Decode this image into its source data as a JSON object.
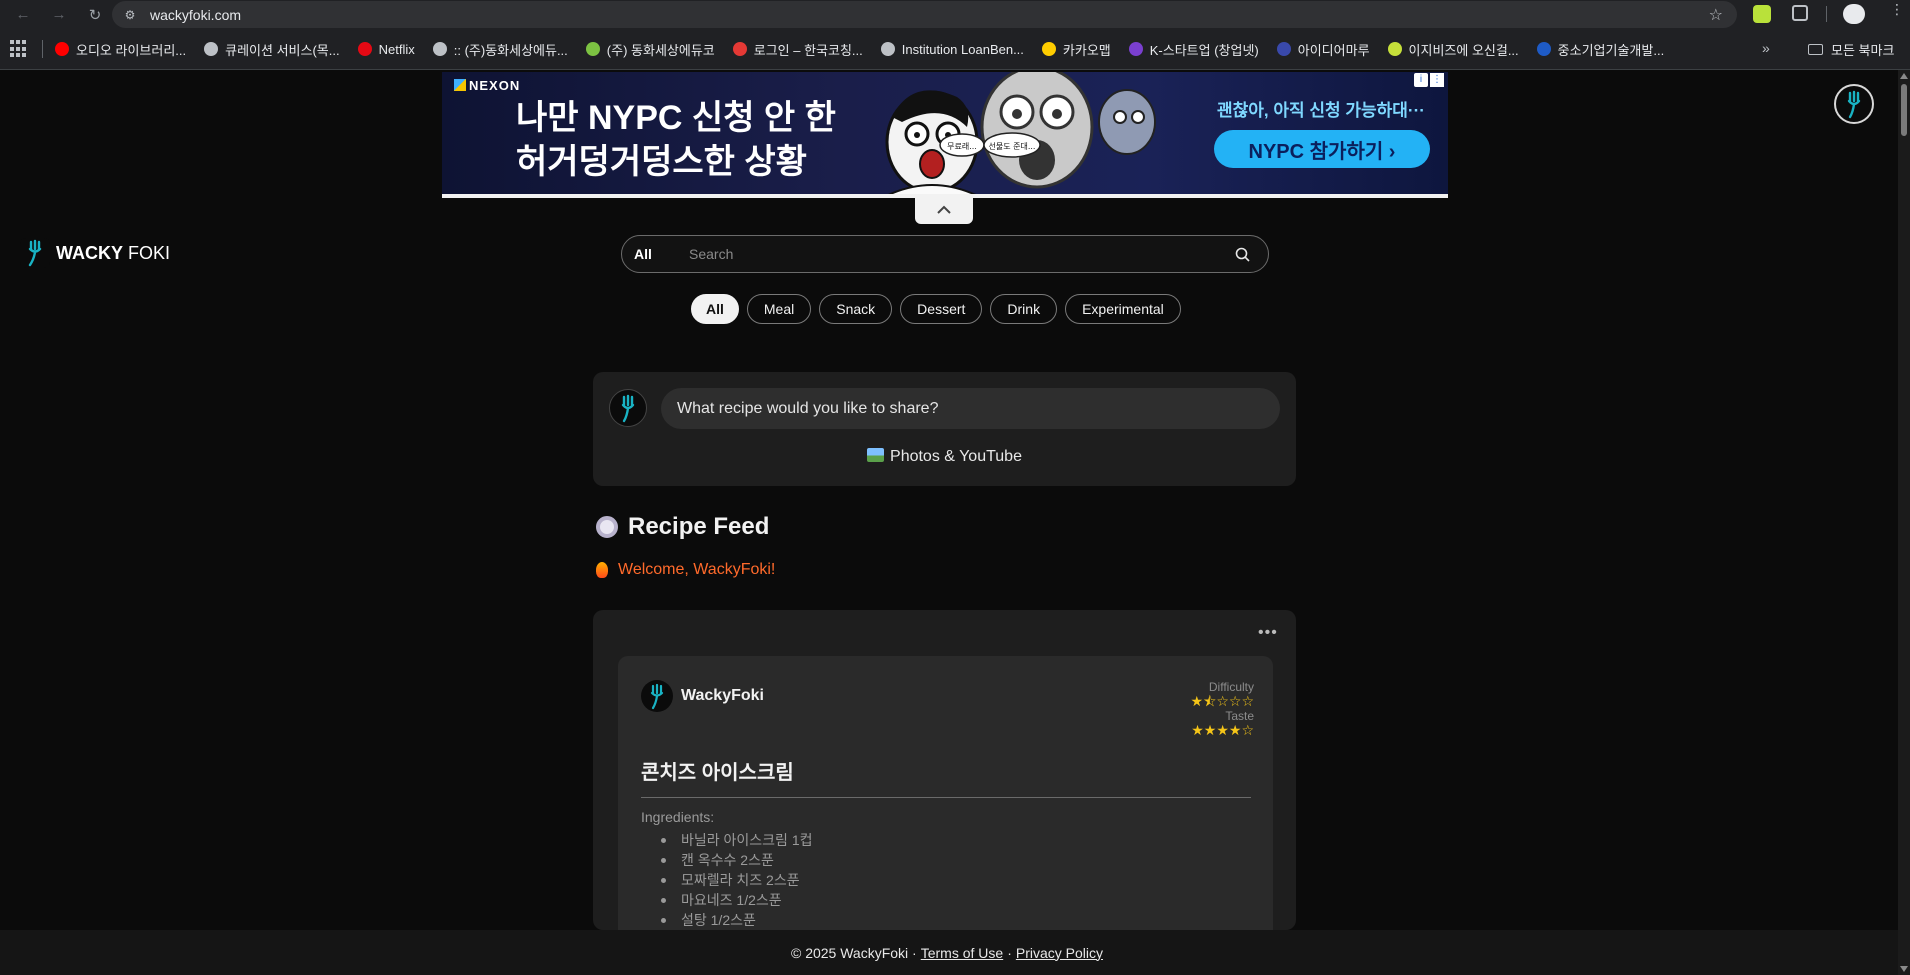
{
  "browser": {
    "url": "wackyfoki.com",
    "bookmarks": [
      {
        "label": "오디오 라이브러리...",
        "color": "#ff0000"
      },
      {
        "label": "큐레이션 서비스(목...",
        "color": "#bdc1c6"
      },
      {
        "label": "Netflix",
        "color": "#e50914"
      },
      {
        "label": ":: (주)동화세상에듀...",
        "color": "#bdc1c6"
      },
      {
        "label": "(주) 동화세상에듀코",
        "color": "#7cc242"
      },
      {
        "label": "로그인 – 한국코칭...",
        "color": "#e53935"
      },
      {
        "label": "Institution LoanBen...",
        "color": "#bdc1c6"
      },
      {
        "label": "카카오맵",
        "color": "#ffcd00"
      },
      {
        "label": "K-스타트업 (창업넷)",
        "color": "#7a3fd0"
      },
      {
        "label": "아이디어마루",
        "color": "#3949ab"
      },
      {
        "label": "이지비즈에 오신걸...",
        "color": "#c6e03a"
      },
      {
        "label": "중소기업기술개발...",
        "color": "#1e5bc6"
      }
    ],
    "all_bookmarks": "모든 북마크"
  },
  "ad": {
    "brand": "NEXON",
    "line1": "나만 NYPC 신청 안 한",
    "line2": "허거덩거덩스한 상황",
    "bubble1": "무료래...",
    "bubble2": "선물도 준대...",
    "subline": "괜찮아, 아직 신청 가능하대···",
    "cta": "NYPC 참가하기 ›"
  },
  "site": {
    "logo_bold": "WACKY",
    "logo_light": " FOKI"
  },
  "search": {
    "scope": "All",
    "placeholder": "Search"
  },
  "filters": [
    "All",
    "Meal",
    "Snack",
    "Dessert",
    "Drink",
    "Experimental"
  ],
  "composer": {
    "prompt": "What recipe would you like to share?",
    "media_label": "Photos & YouTube"
  },
  "feed": {
    "title": "Recipe Feed",
    "welcome": "Welcome, WackyFoki!"
  },
  "post": {
    "author": "WackyFoki",
    "difficulty_label": "Difficulty",
    "difficulty_stars": "★⯪☆☆☆",
    "taste_label": "Taste",
    "taste_stars": "★★★★☆",
    "difficulty_value": 1.5,
    "taste_value": 4,
    "title": "콘치즈 아이스크림",
    "ingredients_label": "Ingredients:",
    "ingredients": [
      "바닐라 아이스크림 1컵",
      "캔 옥수수 2스푼",
      "모짜렐라 치즈 2스푼",
      "마요네즈 1/2스푼",
      "설탕 1/2스푼"
    ]
  },
  "footer": {
    "copyright": "© 2025 WackyFoki ·",
    "terms": "Terms of Use",
    "sep": "·",
    "privacy": "Privacy Policy"
  }
}
